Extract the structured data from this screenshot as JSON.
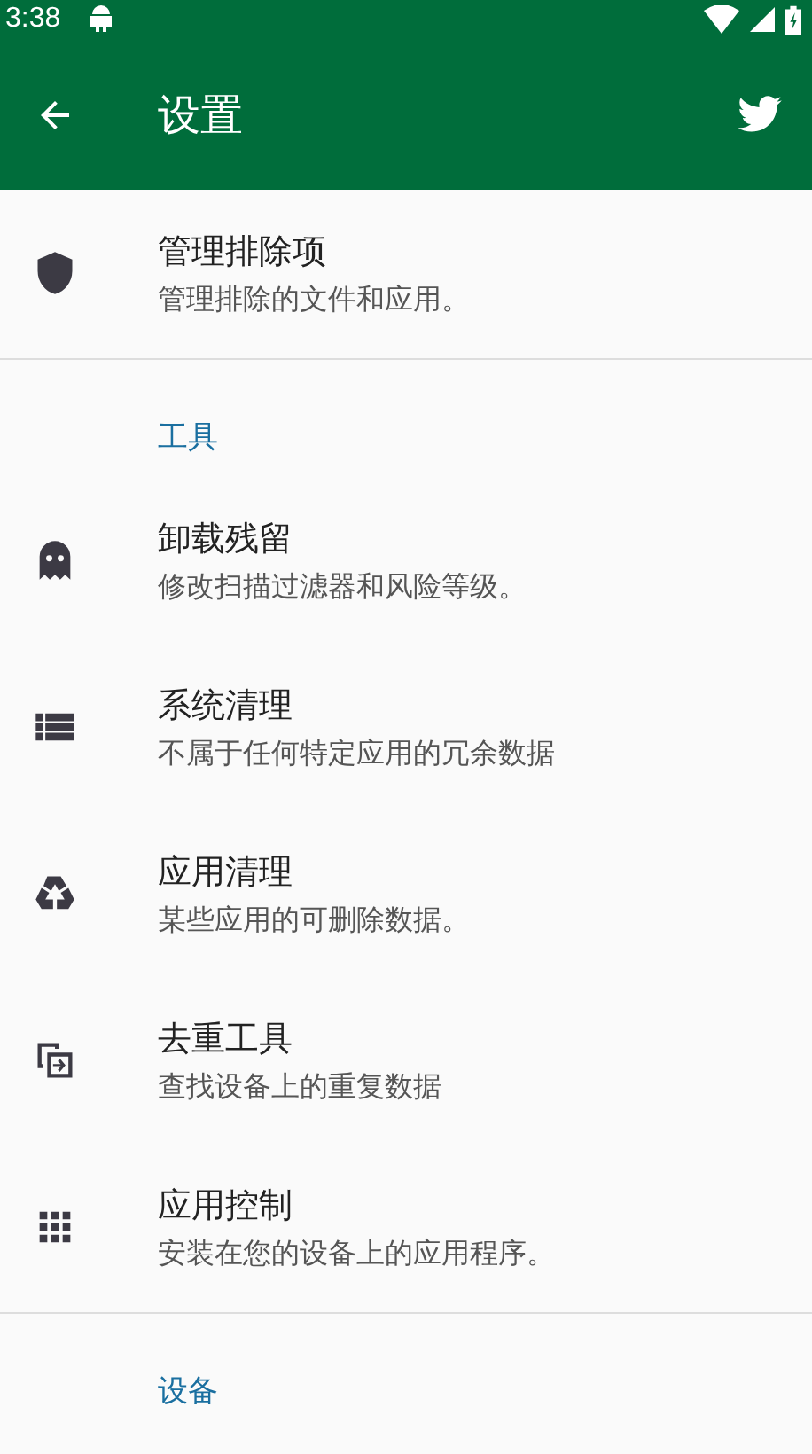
{
  "status_bar": {
    "time": "3:38"
  },
  "app_bar": {
    "title": "设置"
  },
  "sections": [
    {
      "items": [
        {
          "title": "管理排除项",
          "subtitle": "管理排除的文件和应用。"
        }
      ]
    },
    {
      "header": "工具",
      "items": [
        {
          "title": "卸载残留",
          "subtitle": "修改扫描过滤器和风险等级。"
        },
        {
          "title": "系统清理",
          "subtitle": "不属于任何特定应用的冗余数据"
        },
        {
          "title": "应用清理",
          "subtitle": "某些应用的可删除数据。"
        },
        {
          "title": "去重工具",
          "subtitle": "查找设备上的重复数据"
        },
        {
          "title": "应用控制",
          "subtitle": "安装在您的设备上的应用程序。"
        }
      ]
    },
    {
      "header": "设备"
    }
  ]
}
